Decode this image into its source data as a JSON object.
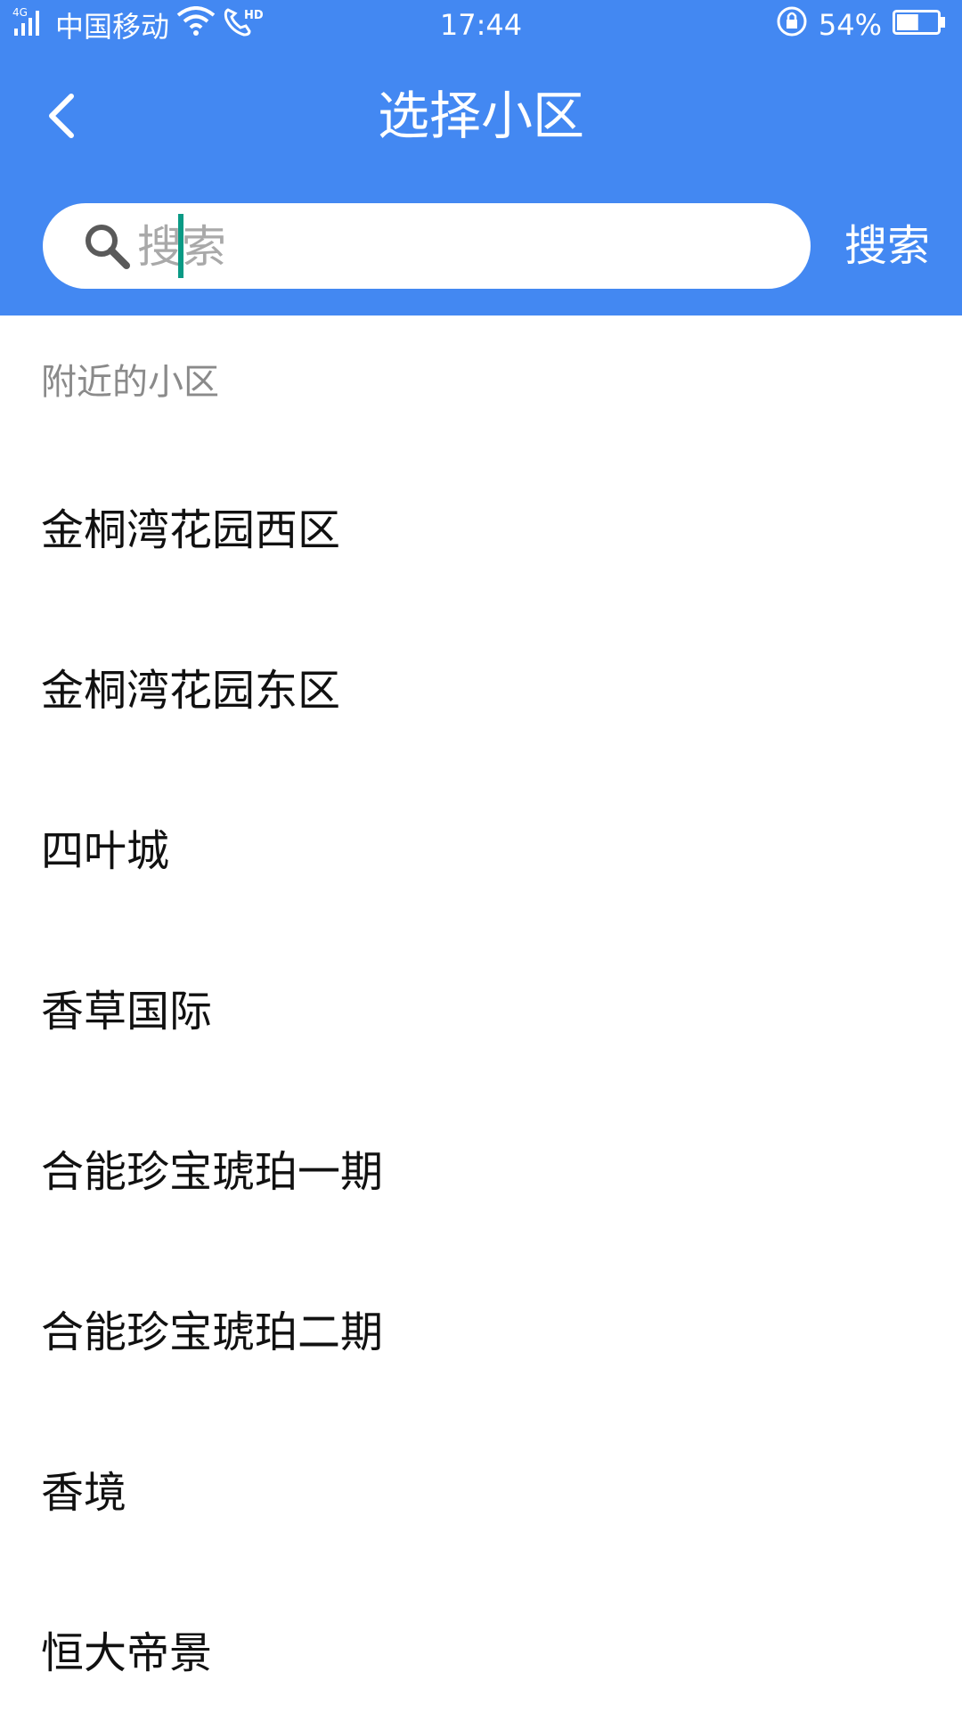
{
  "status_bar": {
    "network": "4G",
    "carrier": "中国移动",
    "hd": "HD",
    "time": "17:44",
    "battery_percent": "54%",
    "battery_level": 0.54
  },
  "header": {
    "title": "选择小区",
    "back_icon": "chevron-left-icon"
  },
  "search": {
    "placeholder": "搜索",
    "value": "",
    "button_label": "搜索",
    "icon": "search-icon"
  },
  "section": {
    "label": "附近的小区"
  },
  "communities": [
    "金桐湾花园西区",
    "金桐湾花园东区",
    "四叶城",
    "香草国际",
    "合能珍宝琥珀一期",
    "合能珍宝琥珀二期",
    "香境",
    "恒大帝景"
  ],
  "colors": {
    "primary": "#4388F2",
    "caret": "#0a9a85",
    "section_text": "#8a8a8a",
    "item_text": "#111111"
  }
}
